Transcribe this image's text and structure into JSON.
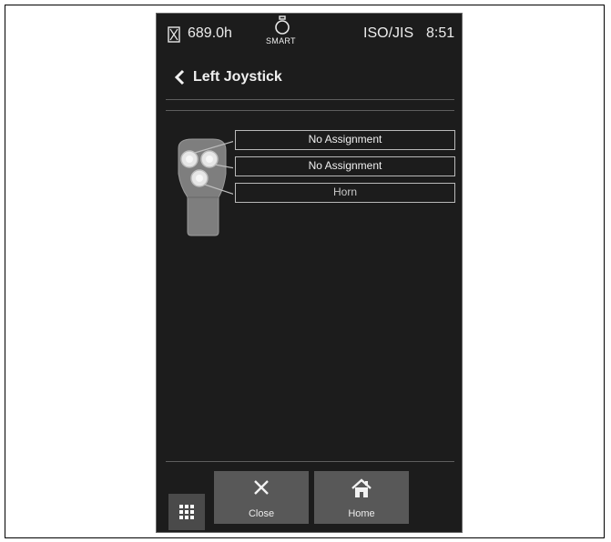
{
  "status_bar": {
    "hours": "689.0h",
    "mode_label": "SMART",
    "pattern": "ISO/JIS",
    "time": "8:51"
  },
  "header": {
    "title": "Left Joystick"
  },
  "joystick": {
    "assignments": [
      {
        "label": "No Assignment"
      },
      {
        "label": "No Assignment"
      },
      {
        "label": "Horn"
      }
    ]
  },
  "bottom_bar": {
    "close_label": "Close",
    "home_label": "Home"
  },
  "icons": {
    "status": [
      "hourglass-icon",
      "engine-icon"
    ],
    "header": [
      "chevron-left-icon"
    ],
    "bottom": [
      "grid-menu-icon",
      "close-icon",
      "home-icon"
    ]
  },
  "colors": {
    "screen_background": "#1c1c1c",
    "button_background": "#585858",
    "border": "#b9b9b9"
  }
}
